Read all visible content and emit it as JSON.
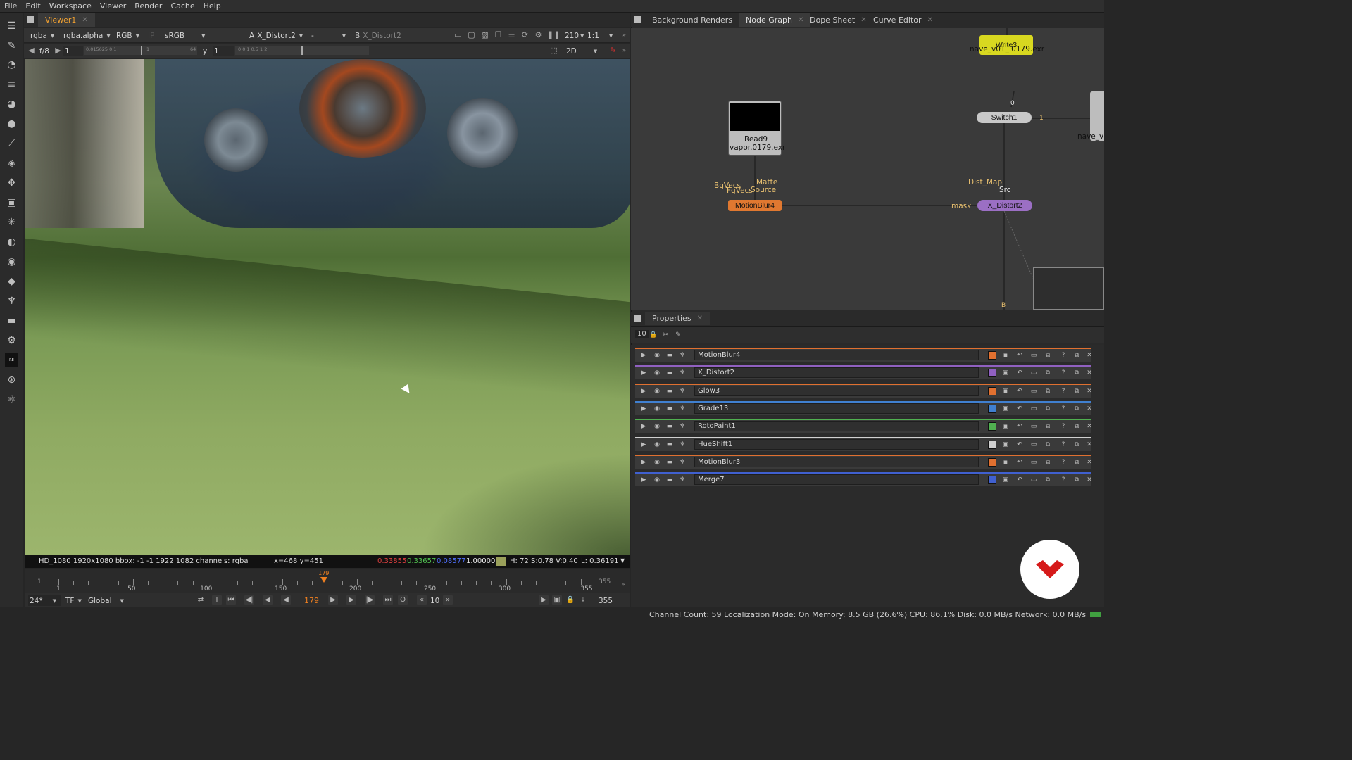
{
  "menu": [
    "File",
    "Edit",
    "Workspace",
    "Viewer",
    "Render",
    "Cache",
    "Help"
  ],
  "viewer": {
    "tab": "Viewer1",
    "channels": "rgba",
    "channel_alpha": "rgba.alpha",
    "display": "RGB",
    "ip": "IP",
    "lut": "sRGB",
    "a_label": "A",
    "a_input": "X_Distort2",
    "ab_mode": "-",
    "b_label": "B",
    "b_input": "X_Distort2",
    "zoom": "210",
    "ratio": "1:1",
    "fstop": "f/8",
    "gain": "1",
    "gamma_label": "y",
    "gamma": "1",
    "gain_ticks": "0.015625  0.1",
    "gain_end": "1",
    "gain_end2": "64",
    "gamma_ticks": "0    0.1    0.5    1    2",
    "view_mode": "2D"
  },
  "info": {
    "format": "HD_1080 1920x1080  bbox: -1 -1 1922 1082 channels: rgba",
    "coords": "x=468 y=451",
    "r": "0.33855",
    "g": "0.33657",
    "b": "0.08577",
    "a": "1.00000",
    "hsv": "H: 72 S:0.78 V:0.40",
    "lum": "L: 0.36191",
    "swatch": "#9aa05a"
  },
  "timeline": {
    "start": "1",
    "end": "355",
    "current": "179",
    "current_value": 179,
    "min": 1,
    "max": 355,
    "labels": [
      "1",
      "50",
      "100",
      "150",
      "200",
      "250",
      "300",
      "355"
    ],
    "fps": "24*",
    "tf": "TF",
    "scope": "Global",
    "step": "10",
    "end_frame": "355",
    "in_frame": "I",
    "out_frame": "O"
  },
  "nodegraph": {
    "tabs": [
      "Background Renders",
      "Node Graph",
      "Dope Sheet",
      "Curve Editor"
    ],
    "write_name": "Write3",
    "write_file": "nave_v01_.0179.exr",
    "read_name": "Read9",
    "read_file": "vapor.0179.exr",
    "switch_name": "Switch1",
    "switch_in0": "0",
    "switch_in1": "1",
    "motionblur_name": "MotionBlur4",
    "xdistort_name": "X_Distort2",
    "in_bgvecs": "BgVecs",
    "in_fgvecs": "FgVecs",
    "in_matte": "Matte",
    "in_source": "Source",
    "in_distmap": "Dist_Map",
    "in_src": "Src",
    "in_mask": "mask",
    "in_b": "B",
    "in_1": "1",
    "cut_label": "nave_v"
  },
  "properties": {
    "tab": "Properties",
    "count": "10",
    "rows": [
      {
        "name": "MotionBlur4",
        "color": "#e07030"
      },
      {
        "name": "X_Distort2",
        "color": "#9060c0"
      },
      {
        "name": "Glow3",
        "color": "#e07030"
      },
      {
        "name": "Grade13",
        "color": "#4080d0"
      },
      {
        "name": "RotoPaint1",
        "color": "#50b050"
      },
      {
        "name": "HueShift1",
        "color": "#d0d0d0"
      },
      {
        "name": "MotionBlur3",
        "color": "#e07030"
      },
      {
        "name": "Merge7",
        "color": "#4060d0"
      }
    ]
  },
  "status": "Channel Count: 59 Localization Mode: On Memory: 8.5 GB (26.6%) CPU: 86.1% Disk: 0.0 MB/s Network: 0.0 MB/s",
  "colors": {
    "accent": "#f08020",
    "write": "#d8d820",
    "xdistort": "#9b6fc4",
    "motionblur": "#e07830",
    "switch": "#c8c8c8"
  }
}
